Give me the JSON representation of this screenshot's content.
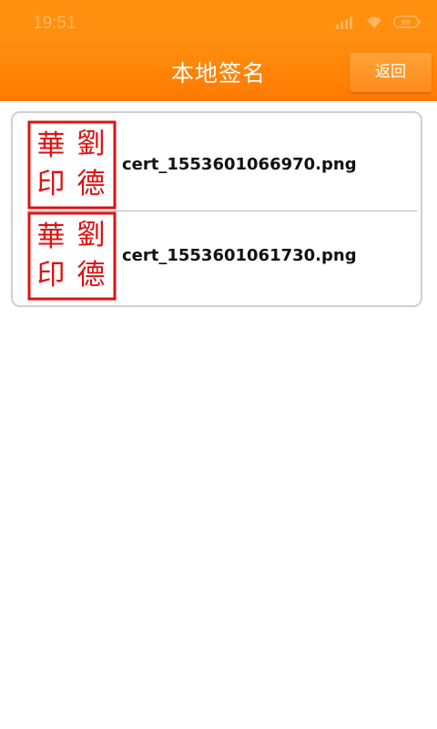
{
  "status_bar": {
    "time": "19:51",
    "battery": "88"
  },
  "header": {
    "title": "本地签名",
    "back_label": "返回"
  },
  "signatures": [
    {
      "filename": "cert_1553601066970.png",
      "seal_chars": [
        "華",
        "劉",
        "印",
        "德"
      ]
    },
    {
      "filename": "cert_1553601061730.png",
      "seal_chars": [
        "華",
        "劉",
        "印",
        "德"
      ]
    }
  ],
  "colors": {
    "header": "#ff8000",
    "seal_red": "#e01010"
  }
}
